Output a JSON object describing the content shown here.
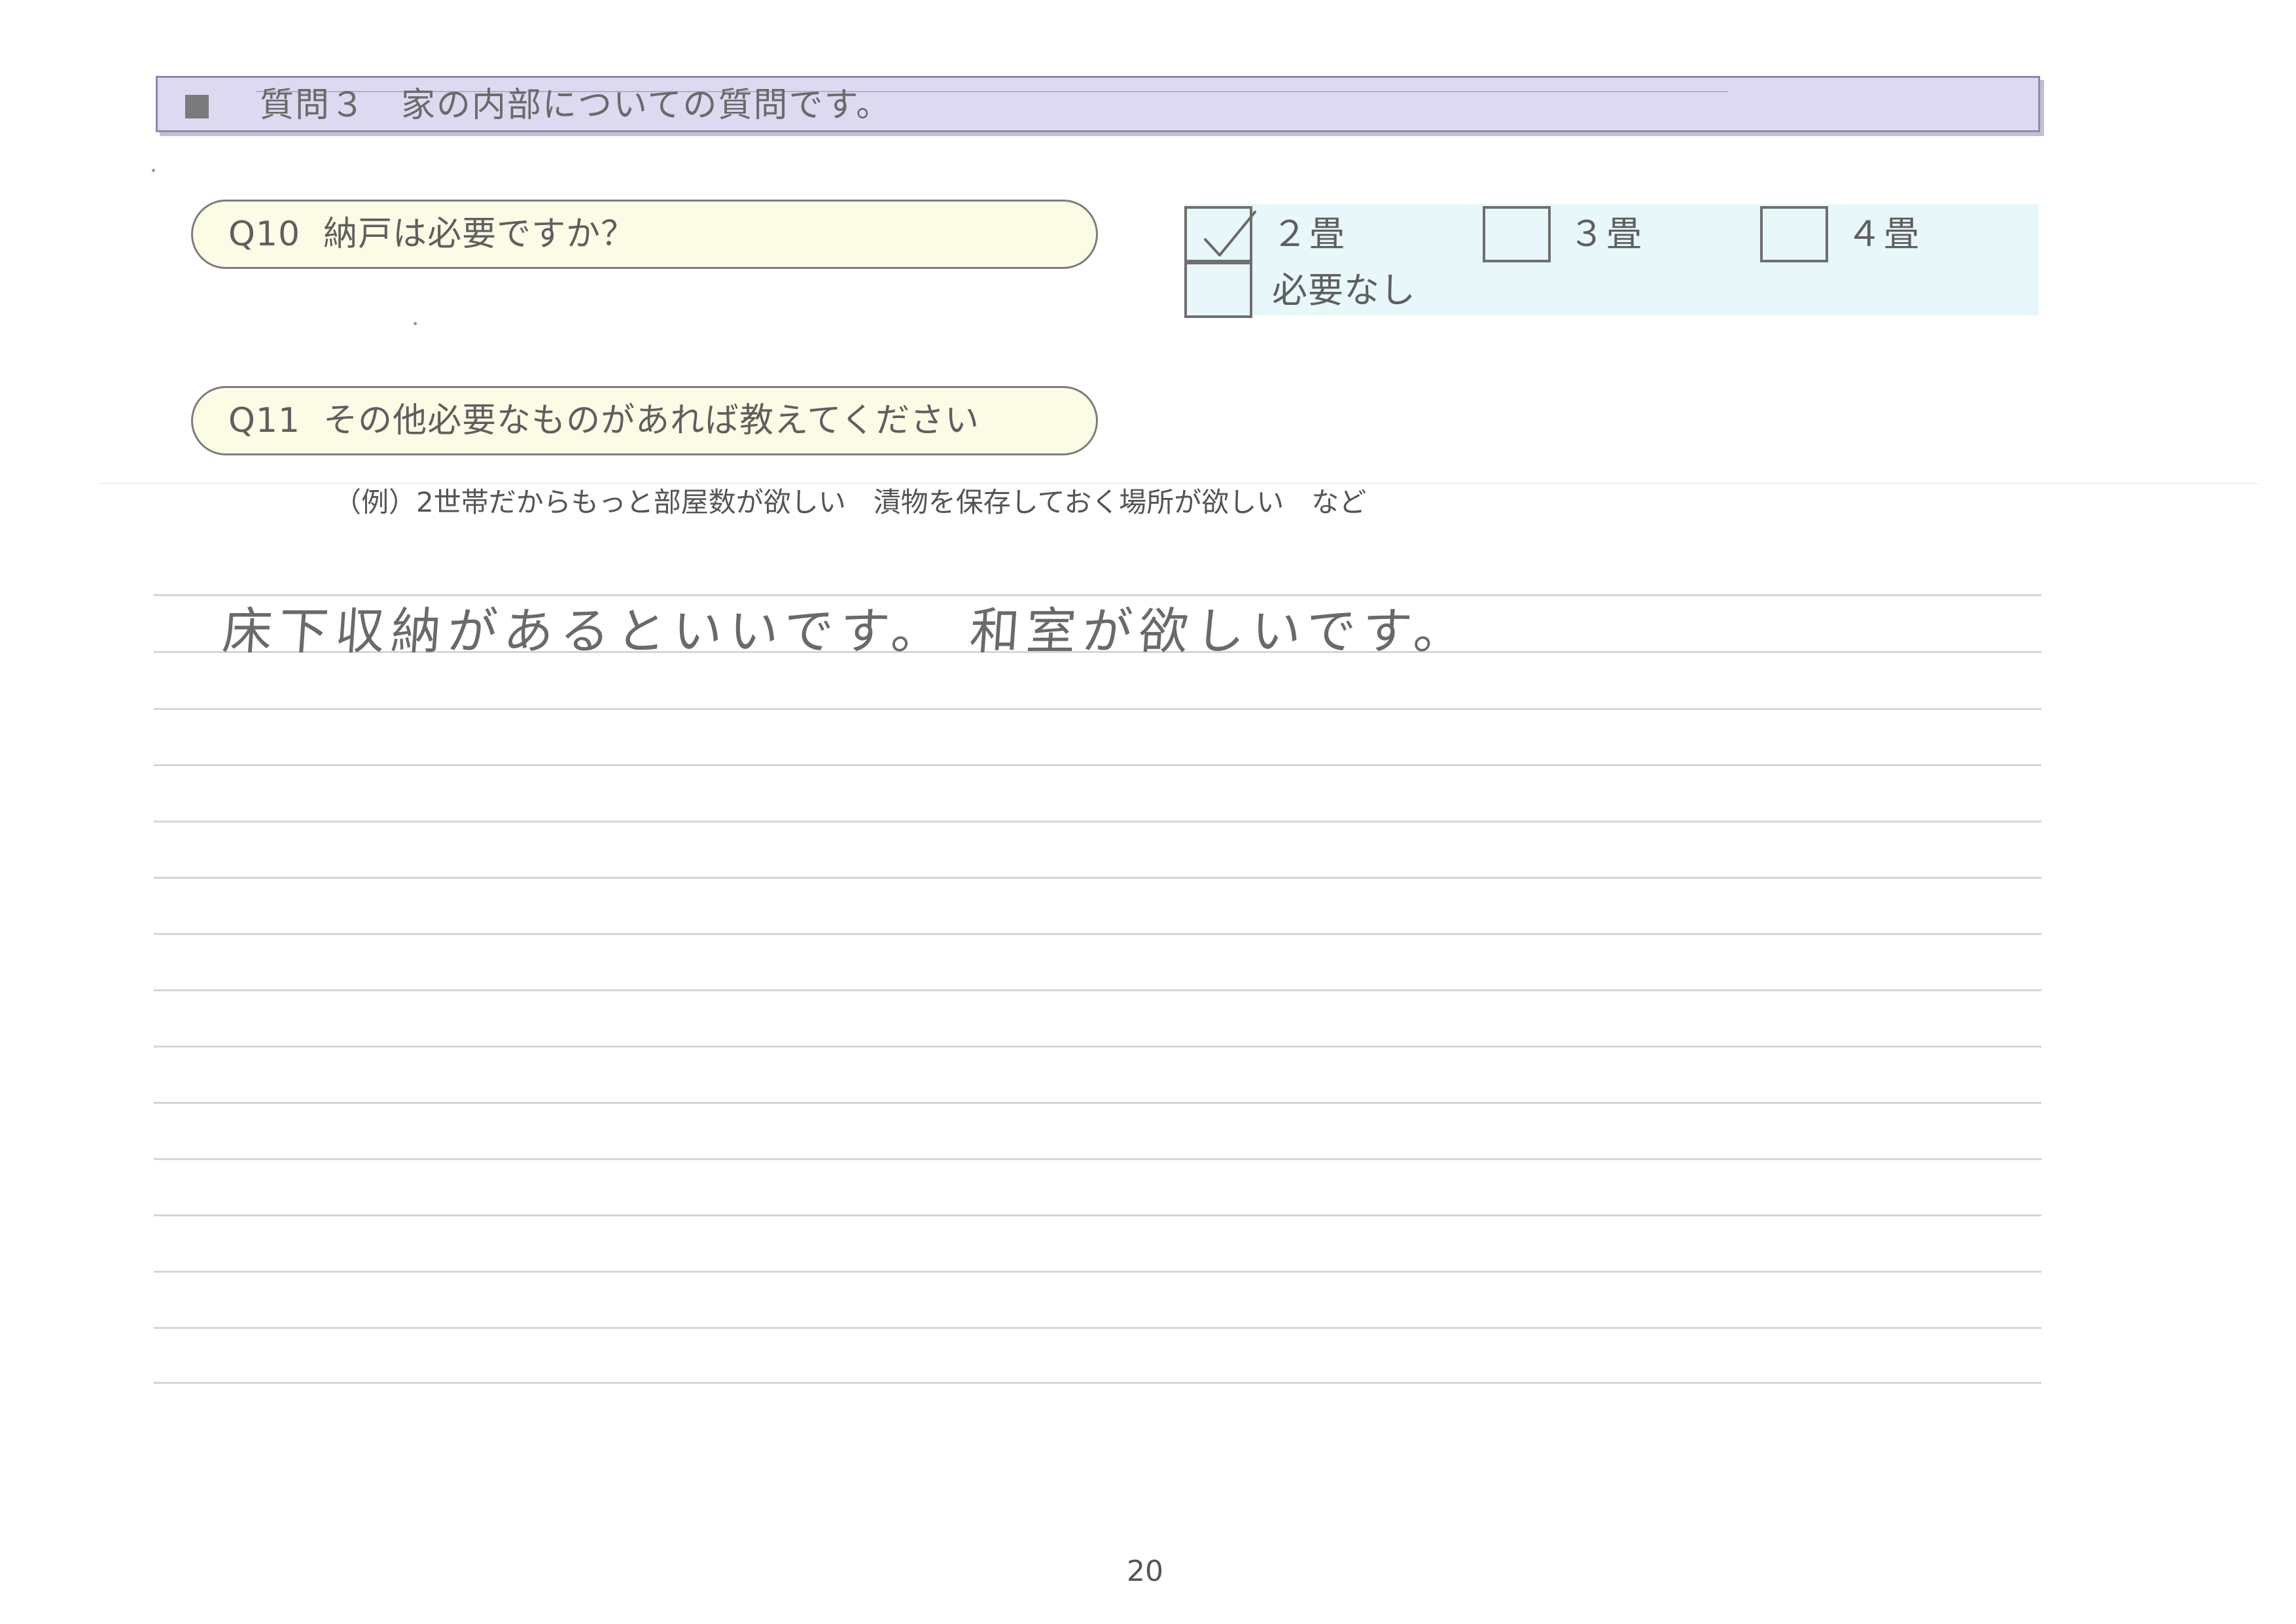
{
  "section": {
    "title": "質問３　家の内部についての質問です。"
  },
  "q10": {
    "question": "Q10  納戸は必要ですか？",
    "options": [
      {
        "label": "２畳",
        "checked": true
      },
      {
        "label": "３畳",
        "checked": false
      },
      {
        "label": "４畳",
        "checked": false
      },
      {
        "label": "必要なし",
        "checked": false
      }
    ]
  },
  "q11": {
    "question": "Q11  その他必要なものがあれば教えてください",
    "example": "（例）2世帯だからもっと部屋数が欲しい　漬物を保存しておく場所が欲しい　など",
    "answer": "床下収納があるといいです。 和室が欲しいです。"
  },
  "page_number": "20"
}
